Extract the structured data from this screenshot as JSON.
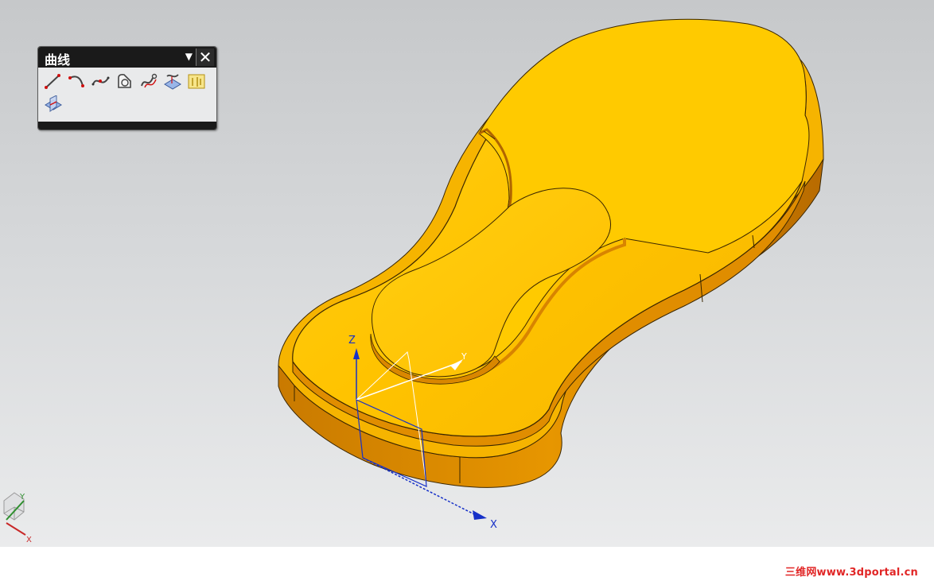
{
  "toolbar": {
    "title": "曲线",
    "menu_glyph": "▼",
    "close_glyph": "✕",
    "tools": [
      {
        "icon": "line-icon"
      },
      {
        "icon": "arc-icon"
      },
      {
        "icon": "studio-spline-icon"
      },
      {
        "icon": "basic-curves-icon"
      },
      {
        "icon": "offset-curve-icon"
      },
      {
        "icon": "project-curve-icon"
      },
      {
        "icon": "text-icon"
      },
      {
        "icon": "intersection-curve-icon"
      }
    ]
  },
  "csys": {
    "z_label": "Z",
    "x_label": "X",
    "y_label": "Y"
  },
  "triad": {
    "x_label": "X",
    "y_label": "Y"
  },
  "watermark": "三维网www.3dportal.cn",
  "colors": {
    "part_top": "#ffc400",
    "part_side": "#d98700",
    "axis_blue": "#1630c8",
    "watermark_red": "#e12626"
  }
}
